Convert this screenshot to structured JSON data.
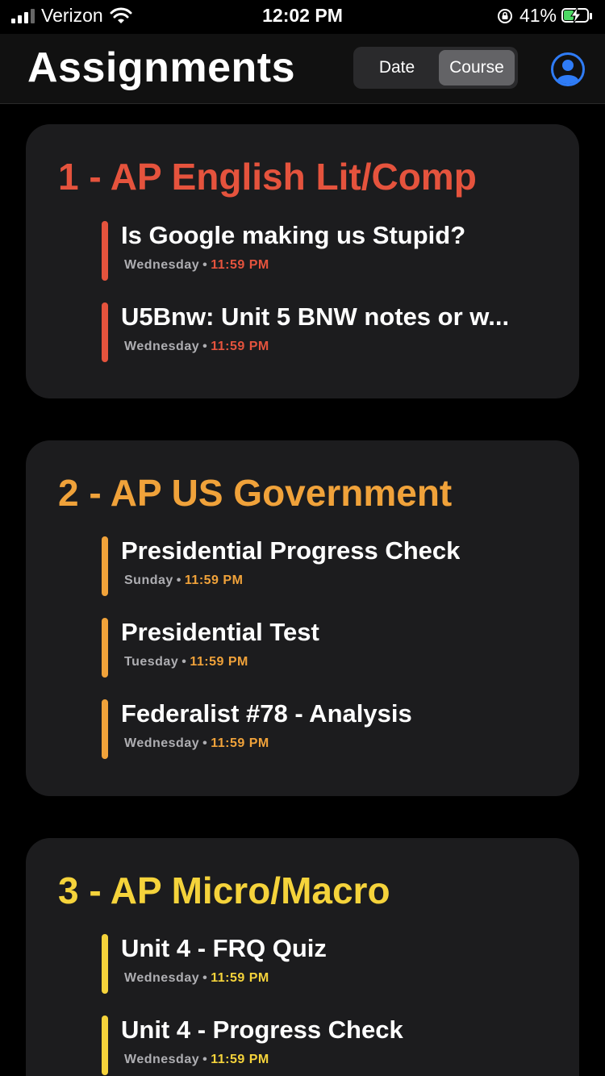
{
  "status_bar": {
    "carrier": "Verizon",
    "time": "12:02 PM",
    "battery": "41%"
  },
  "header": {
    "title": "Assignments",
    "segments": [
      "Date",
      "Course"
    ],
    "selected_segment": "Course"
  },
  "courses": [
    {
      "title": "1 - AP English Lit/Comp",
      "color": "#e5533d",
      "assignments": [
        {
          "name": "Is Google making us Stupid?",
          "day": "Wednesday",
          "time": "11:59 PM"
        },
        {
          "name": "U5Bnw:  Unit 5 BNW notes or w...",
          "day": "Wednesday",
          "time": "11:59 PM"
        }
      ]
    },
    {
      "title": "2 - AP US Government",
      "color": "#f0a23a",
      "assignments": [
        {
          "name": "Presidential Progress Check",
          "day": "Sunday",
          "time": "11:59 PM"
        },
        {
          "name": "Presidential Test",
          "day": "Tuesday",
          "time": "11:59 PM"
        },
        {
          "name": "Federalist #78 - Analysis",
          "day": "Wednesday",
          "time": "11:59 PM"
        }
      ]
    },
    {
      "title": "3 - AP Micro/Macro",
      "color": "#f5d33b",
      "assignments": [
        {
          "name": "Unit 4 - FRQ Quiz",
          "day": "Wednesday",
          "time": "11:59 PM"
        },
        {
          "name": "Unit 4 - Progress Check",
          "day": "Wednesday",
          "time": "11:59 PM"
        }
      ]
    }
  ],
  "separator": "•"
}
